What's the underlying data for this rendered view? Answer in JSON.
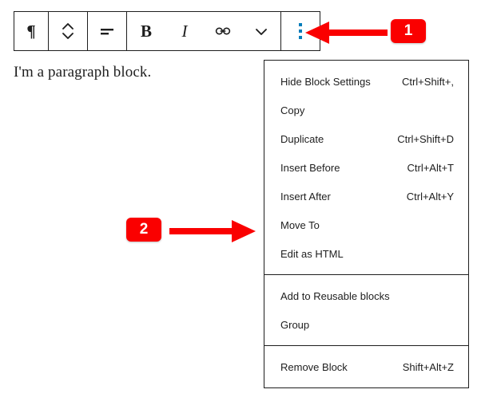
{
  "toolbar": {
    "name": "block-toolbar",
    "buttons": [
      {
        "id": "block-type",
        "icon": "pilcrow-icon",
        "label": "¶",
        "title": "Paragraph"
      },
      {
        "id": "move-updown",
        "icon": "move-up-down-icon",
        "title": "Move up or down"
      },
      {
        "id": "align",
        "icon": "align-text-left-icon",
        "title": "Change alignment"
      },
      {
        "id": "bold",
        "icon": "bold-icon",
        "label": "B",
        "title": "Bold"
      },
      {
        "id": "italic",
        "icon": "italic-icon",
        "label": "I",
        "title": "Italic"
      },
      {
        "id": "link",
        "icon": "link-icon",
        "title": "Link"
      },
      {
        "id": "more-formatting",
        "icon": "chevron-down-icon",
        "title": "More rich text controls"
      },
      {
        "id": "block-options",
        "icon": "dots-vertical-icon",
        "title": "Options"
      }
    ]
  },
  "content": {
    "paragraph_text": "I'm a paragraph block."
  },
  "menu": {
    "name": "block-options-menu",
    "sections": [
      {
        "items": [
          {
            "label": "Hide Block Settings",
            "shortcut": "Ctrl+Shift+,"
          },
          {
            "label": "Copy",
            "shortcut": ""
          },
          {
            "label": "Duplicate",
            "shortcut": "Ctrl+Shift+D"
          },
          {
            "label": "Insert Before",
            "shortcut": "Ctrl+Alt+T"
          },
          {
            "label": "Insert After",
            "shortcut": "Ctrl+Alt+Y"
          },
          {
            "label": "Move To",
            "shortcut": ""
          },
          {
            "label": "Edit as HTML",
            "shortcut": ""
          }
        ]
      },
      {
        "items": [
          {
            "label": "Add to Reusable blocks",
            "shortcut": ""
          },
          {
            "label": "Group",
            "shortcut": ""
          }
        ]
      },
      {
        "items": [
          {
            "label": "Remove Block",
            "shortcut": "Shift+Alt+Z"
          }
        ]
      }
    ]
  },
  "annotations": {
    "accent_color": "#fa0000",
    "badges": [
      {
        "id": "annotation-badge-1",
        "label": "1"
      },
      {
        "id": "annotation-badge-2",
        "label": "2"
      }
    ]
  },
  "colors": {
    "accent_blue": "#007cba",
    "border_dark": "#1e1e1e",
    "annotation_red": "#fa0000",
    "background": "#ffffff"
  }
}
